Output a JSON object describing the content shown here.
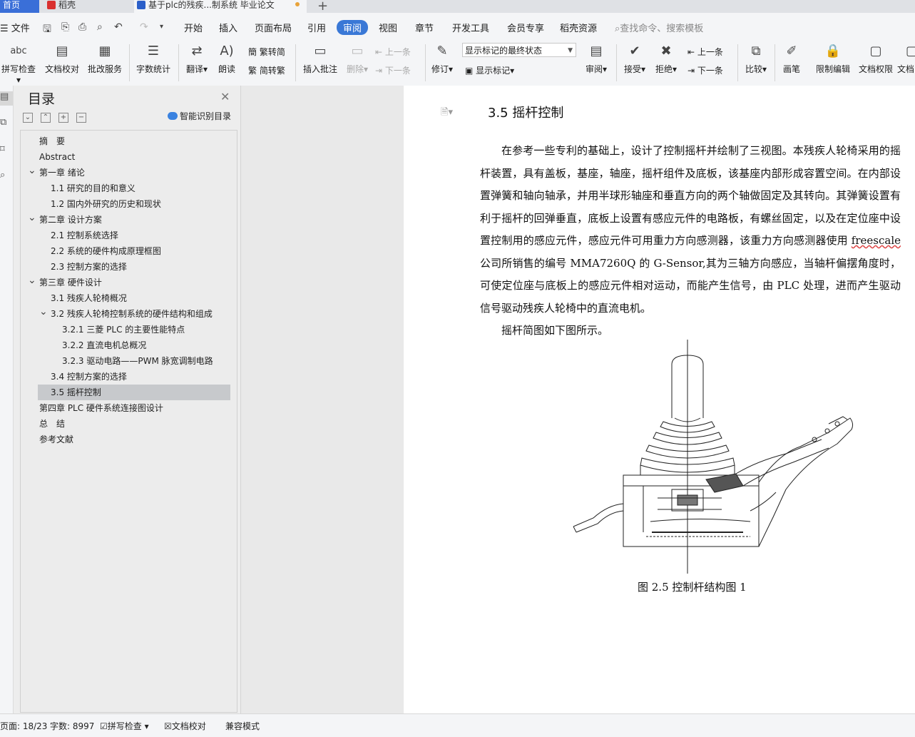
{
  "tabs": [
    {
      "label": "首页"
    },
    {
      "label": "稻壳"
    },
    {
      "label": "基于plc的残疾...制系统 毕业论文"
    }
  ],
  "menubar": {
    "file": "文件",
    "tabs": [
      "开始",
      "插入",
      "页面布局",
      "引用",
      "审阅",
      "视图",
      "章节",
      "开发工具",
      "会员专享",
      "稻壳资源"
    ],
    "active_tab": "审阅",
    "search": "查找命令、搜索模板"
  },
  "ribbon": {
    "spell": "拼写检查",
    "doc_check": "文档校对",
    "batch": "批改服务",
    "word_count": "字数统计",
    "translate": "翻译",
    "read": "朗读",
    "trad_simp": "繁转简",
    "simp_trad": "简转繁",
    "insert_comment": "插入批注",
    "delete": "删除",
    "prev": "上一条",
    "next": "下一条",
    "revise": "修订",
    "markup_state": "显示标记的最终状态",
    "show_markup": "显示标记",
    "review": "审阅",
    "accept": "接受",
    "reject": "拒绝",
    "prev2": "上一条",
    "next2": "下一条",
    "compare": "比较",
    "pen": "画笔",
    "restrict": "限制编辑",
    "doc_perm": "文档权限",
    "doc_more": "文档"
  },
  "nav": {
    "title": "目录",
    "smart": "智能识别目录",
    "items": [
      {
        "label": "摘　要",
        "level": 0,
        "arrow": ""
      },
      {
        "label": "Abstract",
        "level": 0,
        "arrow": ""
      },
      {
        "label": "第一章  绪论",
        "level": 0,
        "arrow": "v"
      },
      {
        "label": "1.1 研究的目的和意义",
        "level": 1,
        "arrow": ""
      },
      {
        "label": "1.2 国内外研究的历史和现状",
        "level": 1,
        "arrow": ""
      },
      {
        "label": "第二章  设计方案",
        "level": 0,
        "arrow": "v"
      },
      {
        "label": "2.1 控制系统选择",
        "level": 1,
        "arrow": ""
      },
      {
        "label": "2.2  系统的硬件构成原理框图",
        "level": 1,
        "arrow": ""
      },
      {
        "label": "2.3  控制方案的选择",
        "level": 1,
        "arrow": ""
      },
      {
        "label": "第三章  硬件设计",
        "level": 0,
        "arrow": "v"
      },
      {
        "label": "3.1 残疾人轮椅概况",
        "level": 1,
        "arrow": ""
      },
      {
        "label": "3.2 残疾人轮椅控制系统的硬件结构和组成",
        "level": 1,
        "arrow": "v"
      },
      {
        "label": "3.2.1  三菱 PLC 的主要性能特点",
        "level": 2,
        "arrow": ""
      },
      {
        "label": "3.2.2 直流电机总概况",
        "level": 2,
        "arrow": ""
      },
      {
        "label": "3.2.3  驱动电路——PWM 脉宽调制电路",
        "level": 2,
        "arrow": ""
      },
      {
        "label": "3.4 控制方案的选择",
        "level": 1,
        "arrow": ""
      },
      {
        "label": "3.5 摇杆控制",
        "level": 1,
        "arrow": "",
        "selected": true
      },
      {
        "label": "第四章  PLC 硬件系统连接图设计",
        "level": 0,
        "arrow": ""
      },
      {
        "label": "总　结",
        "level": 0,
        "arrow": ""
      },
      {
        "label": "参考文献",
        "level": 0,
        "arrow": ""
      }
    ]
  },
  "doc": {
    "heading": "3.5 摇杆控制",
    "para1_a": "在参考一些专利的基础上，设计了控制摇杆并绘制了三视图。本残疾人轮椅采用的摇杆装置，具有盖板，基座，轴座，摇杆组件及底板，该基座内部形成容置空间。在内部设置弹簧和轴向轴承，并用半球形轴座和垂直方向的两个轴做固定及其转向。其弹簧设置有利于摇杆的回弹垂直，底板上设置有感应元件的电路板，有螺丝固定，以及在定位座中设置控制用的感应元件，感应元件可用重力方向感测器，该重力方向感测器使用 ",
    "para1_u": "freescale",
    "para1_b": " 公司所销售的编号 MMA7260Q 的 G-Sensor,其为三轴方向感应，当轴杆偏摆角度时，可使定位座与底板上的感应元件相对运动，而能产生信号，由 PLC 处理，进而产生驱动信号驱动残疾人轮椅中的直流电机。",
    "para2": "摇杆简图如下图所示。",
    "caption": "图 2.5  控制杆结构图 1"
  },
  "status": {
    "page": "页面: 18/23",
    "words": "字数: 8997",
    "spell": "拼写检查",
    "check": "文档校对",
    "compat": "兼容模式"
  },
  "colors": {
    "accent": "#3a78d6",
    "selection": "#c7c9cc"
  }
}
